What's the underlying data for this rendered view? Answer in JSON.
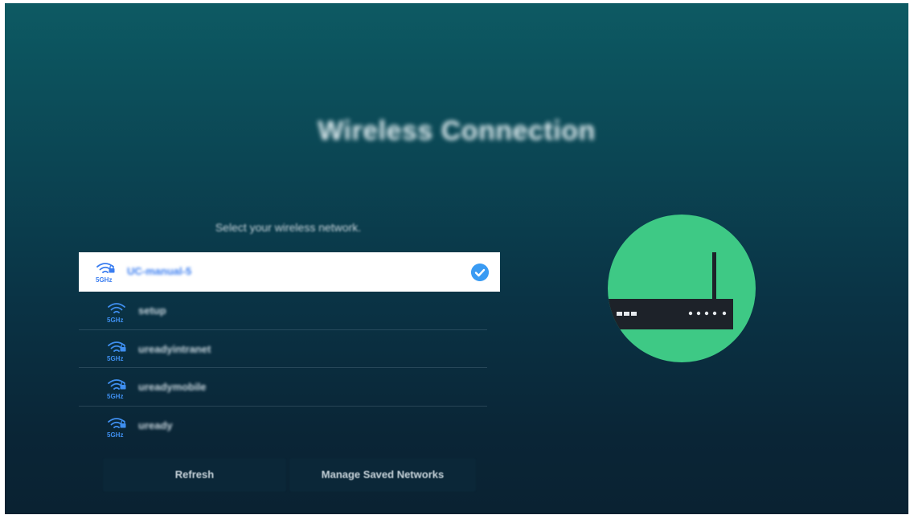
{
  "title": "Wireless Connection",
  "prompt": "Select your wireless network.",
  "networks": [
    {
      "ssid": "UC-manual-5",
      "band": "5GHz",
      "selected": true
    },
    {
      "ssid": "setup",
      "band": "5GHz",
      "selected": false
    },
    {
      "ssid": "ureadyintranet",
      "band": "5GHz",
      "selected": false
    },
    {
      "ssid": "ureadymobile",
      "band": "5GHz",
      "selected": false
    },
    {
      "ssid": "uready",
      "band": "5GHz",
      "selected": false
    }
  ],
  "buttons": {
    "refresh": "Refresh",
    "manage": "Manage Saved Networks"
  },
  "icons": {
    "network": "wifi-lock-icon",
    "selected": "check-circle-icon",
    "illustration": "router-illustration"
  },
  "colors": {
    "accent": "#3a7df0",
    "check": "#3a9bf3",
    "illustration_bg": "#3ec985",
    "selected_bg": "#ffffff"
  }
}
